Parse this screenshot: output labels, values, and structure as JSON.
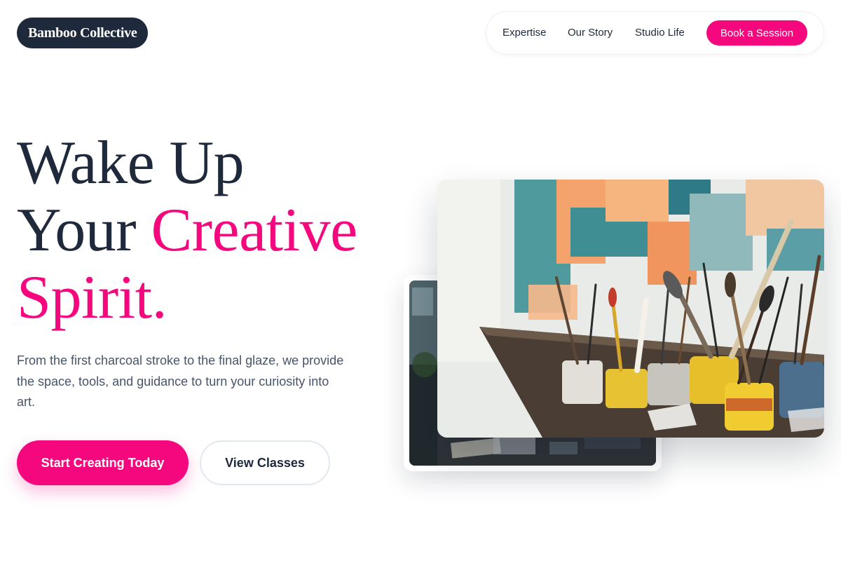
{
  "brand": {
    "name": "Bamboo Collective"
  },
  "nav": {
    "links": [
      "Expertise",
      "Our Story",
      "Studio Life"
    ],
    "cta": "Book a Session"
  },
  "hero": {
    "title_line1": "Wake Up",
    "title_line2_plain": "Your ",
    "title_line2_accent": "Creative",
    "title_line3_accent": "Spirit.",
    "description": "From the first charcoal stroke to the final glaze, we provide the space, tools, and guidance to turn your curiosity into art.",
    "primary_button": "Start Creating Today",
    "secondary_button": "View Classes"
  },
  "images": {
    "front": "studio-paint-brushes-photo",
    "back": "studio-workbench-photo"
  },
  "colors": {
    "accent": "#f5087e",
    "dark": "#1e293b",
    "muted_text": "#475569",
    "border": "#e2e8f0"
  }
}
